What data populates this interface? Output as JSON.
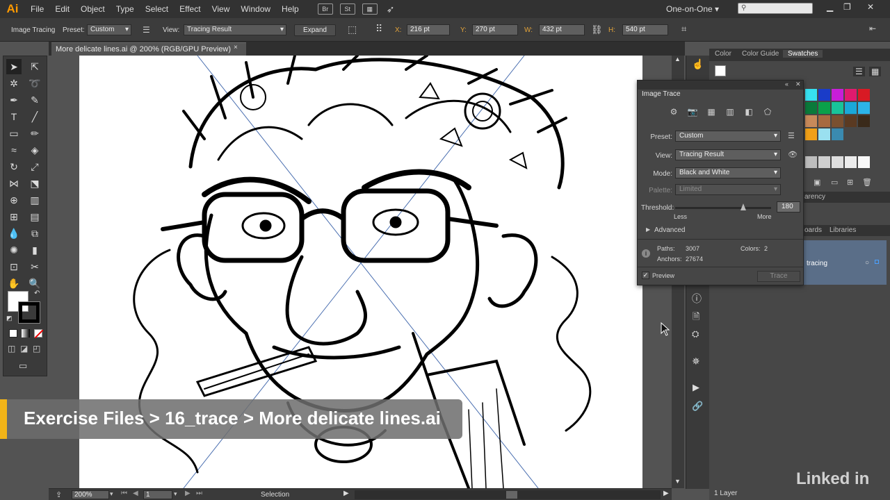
{
  "app": {
    "logo": "Ai",
    "workspace": "One-on-One ▾",
    "search_placeholder": "",
    "menus": [
      "File",
      "Edit",
      "Object",
      "Type",
      "Select",
      "Effect",
      "View",
      "Window",
      "Help"
    ],
    "bridge_label": "Br",
    "stock_label": "St"
  },
  "controlbar": {
    "mode_label": "Image Tracing",
    "preset_label": "Preset:",
    "preset_value": "Custom",
    "view_label": "View:",
    "view_value": "Tracing Result",
    "expand_label": "Expand",
    "x_label": "X:",
    "x_value": "216 pt",
    "y_label": "Y:",
    "y_value": "270 pt",
    "w_label": "W:",
    "w_value": "432 pt",
    "h_label": "H:",
    "h_value": "540 pt"
  },
  "document": {
    "tab_title": "More delicate lines.ai @ 200% (RGB/GPU Preview)",
    "close_glyph": "×"
  },
  "status": {
    "zoom": "200%",
    "page": "1",
    "tool": "Selection"
  },
  "banner": {
    "text": "Exercise Files > 16_trace > More delicate lines.ai"
  },
  "right_panel": {
    "tabs": [
      "Color",
      "Color Guide",
      "Swatches"
    ],
    "transparency_fragment": "arency",
    "layers_tabs_fragment": "oards",
    "libraries_tab": "Libraries",
    "layer_name": "tracing",
    "layer_count": "1 Layer"
  },
  "image_trace": {
    "title": "Image Trace",
    "preset_label": "Preset:",
    "preset_value": "Custom",
    "view_label": "View:",
    "view_value": "Tracing Result",
    "mode_label": "Mode:",
    "mode_value": "Black and White",
    "palette_label": "Palette:",
    "palette_value": "Limited",
    "threshold_label": "Threshold:",
    "threshold_value": "180",
    "threshold_fraction": 0.71,
    "less_label": "Less",
    "more_label": "More",
    "advanced_label": "Advanced",
    "paths_label": "Paths:",
    "paths_value": "3007",
    "colors_label": "Colors:",
    "colors_value": "2",
    "anchors_label": "Anchors:",
    "anchors_value": "27674",
    "preview_label": "Preview",
    "preview_checked": true,
    "trace_button": "Trace"
  },
  "watermark": "Linked in",
  "colors": {
    "accent_orange": "#ff9a00",
    "banner_yellow": "#f2b418",
    "layer_highlight": "#5a6e88"
  }
}
